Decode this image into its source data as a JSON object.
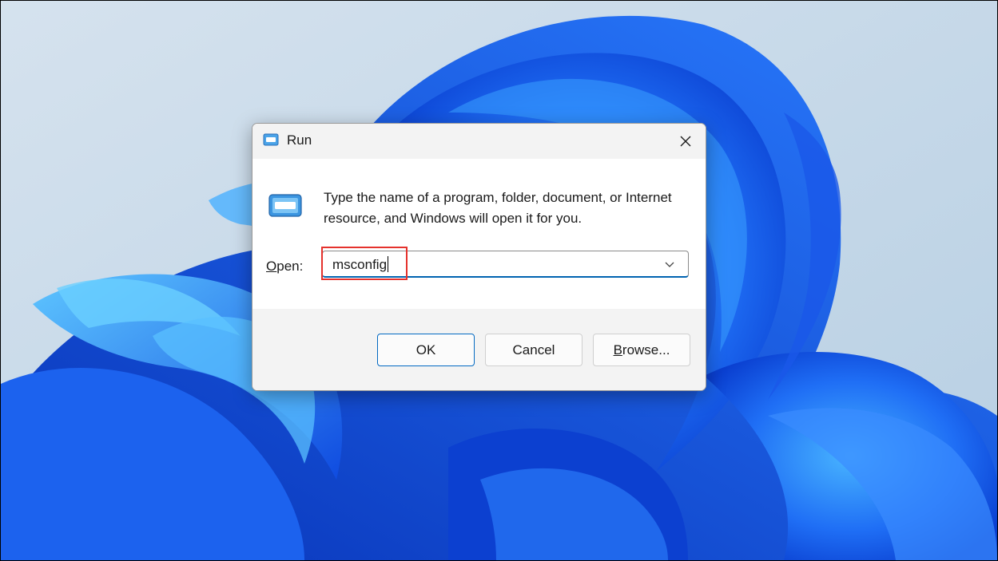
{
  "dialog": {
    "title": "Run",
    "description": "Type the name of a program, folder, document, or Internet resource, and Windows will open it for you.",
    "open_label_accel": "O",
    "open_label_rest": "pen:",
    "open_value": "msconfig"
  },
  "buttons": {
    "ok_label": "OK",
    "cancel_label": "Cancel",
    "browse_accel": "B",
    "browse_rest": "rowse..."
  },
  "colors": {
    "accent": "#0067c0",
    "highlight_box": "#e5322d",
    "wallpaper_base": "#c7d8e6",
    "bloom_blue": "#1a5cf0"
  },
  "icons": {
    "title": "run-app-icon",
    "body": "run-app-icon",
    "close": "close-icon",
    "dropdown": "chevron-down-icon"
  }
}
